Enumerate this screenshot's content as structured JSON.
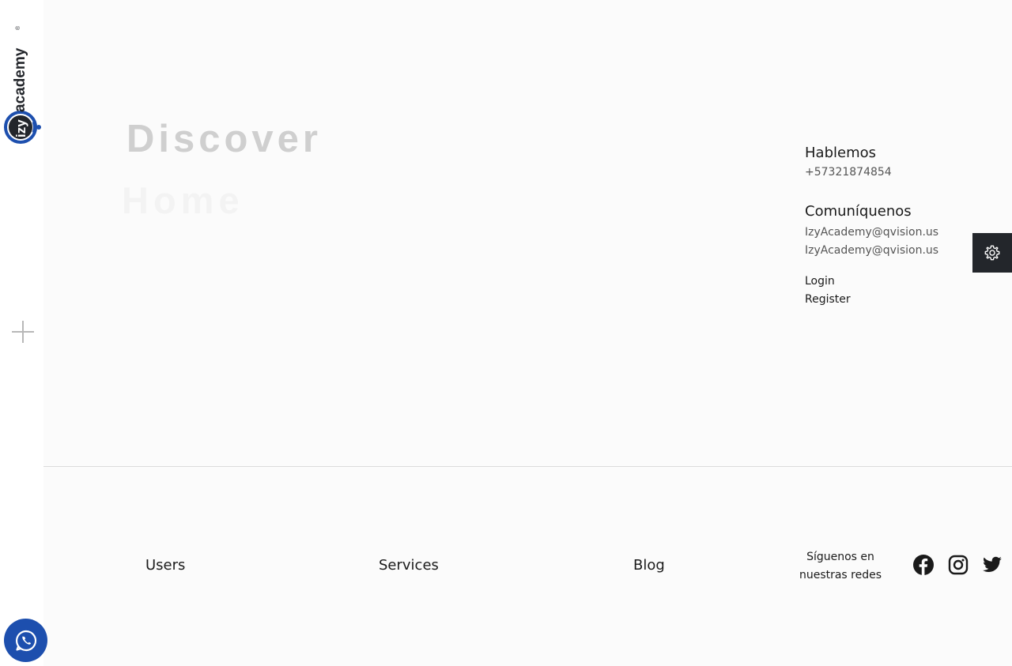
{
  "brand": {
    "name": "izyacademy",
    "registered_mark": "®",
    "colors": {
      "primary": "#1d4fae",
      "dark": "#23262b"
    }
  },
  "sidebar": {
    "expand_icon": "plus-icon",
    "chat_icon": "whatsapp-icon"
  },
  "hero": {
    "line1": "Discover",
    "line2": "Home"
  },
  "contact": {
    "talk_heading": "Hablemos",
    "phone": "+57321874854",
    "write_heading": "Comuníquenos",
    "emails": [
      "IzyAcademy@qvision.us",
      "IzyAcademy@qvision.us"
    ],
    "login": "Login",
    "register": "Register"
  },
  "settings": {
    "icon": "gear-icon"
  },
  "footer": {
    "nav": [
      {
        "label": "Users"
      },
      {
        "label": "Services"
      },
      {
        "label": "Blog"
      }
    ],
    "social_text": "Síguenos en nuestras redes",
    "social_icons": [
      "facebook-icon",
      "instagram-icon",
      "twitter-icon"
    ]
  }
}
